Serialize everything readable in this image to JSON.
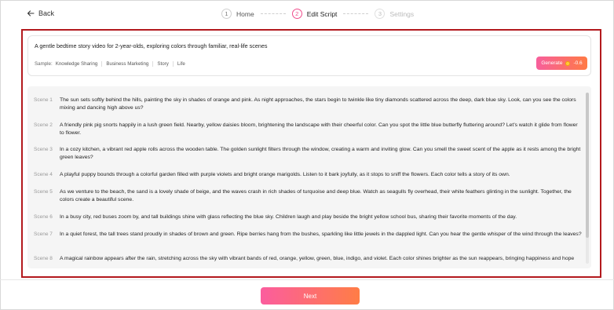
{
  "nav": {
    "back_label": "Back"
  },
  "steps": [
    {
      "num": "1",
      "label": "Home"
    },
    {
      "num": "2",
      "label": "Edit Script"
    },
    {
      "num": "3",
      "label": "Settings"
    }
  ],
  "prompt": {
    "text": "A gentle bedtime story video for 2-year-olds, exploring colors through familiar, real-life scenes",
    "sample_label": "Sample:",
    "samples": [
      "Knowledge Sharing",
      "Business Marketing",
      "Story",
      "Life"
    ],
    "generate_label": "Generate",
    "generate_cost": "-0.6"
  },
  "scenes": [
    {
      "label": "Scene 1",
      "text": "The sun sets softly behind the hills, painting the sky in shades of orange and pink. As night approaches, the stars begin to twinkle like tiny diamonds scattered across the deep, dark blue sky. Look, can you see the colors mixing and dancing high above us?"
    },
    {
      "label": "Scene 2",
      "text": "A friendly pink pig snorts happily in a lush green field. Nearby, yellow daisies bloom, brightening the landscape with their cheerful color. Can you spot the little blue butterfly fluttering around? Let's watch it glide from flower to flower."
    },
    {
      "label": "Scene 3",
      "text": "In a cozy kitchen, a vibrant red apple rolls across the wooden table. The golden sunlight filters through the window, creating a warm and inviting glow. Can you smell the sweet scent of the apple as it rests among the bright green leaves?"
    },
    {
      "label": "Scene 4",
      "text": "A playful puppy bounds through a colorful garden filled with purple violets and bright orange marigolds. Listen to it bark joyfully, as it stops to sniff the flowers. Each color tells a story of its own."
    },
    {
      "label": "Scene 5",
      "text": "As we venture to the beach, the sand is a lovely shade of beige, and the waves crash in rich shades of turquoise and deep blue. Watch as seagulls fly overhead, their white feathers glinting in the sunlight. Together, the colors create a beautiful scene."
    },
    {
      "label": "Scene 6",
      "text": "In a busy city, red buses zoom by, and tall buildings shine with glass reflecting the blue sky. Children laugh and play beside the bright yellow school bus, sharing their favorite moments of the day."
    },
    {
      "label": "Scene 7",
      "text": "In a quiet forest, the tall trees stand proudly in shades of brown and green. Ripe berries hang from the bushes, sparkling like little jewels in the dappled light. Can you hear the gentle whisper of the wind through the leaves?"
    },
    {
      "label": "Scene 8",
      "text": "A magical rainbow appears after the rain, stretching across the sky with vibrant bands of red, orange, yellow, green, blue, indigo, and violet. Each color shines brighter as the sun reappears, bringing happiness and hope"
    }
  ],
  "footer": {
    "next_label": "Next"
  },
  "colors": {
    "accent_pink": "#f04d8c",
    "accent_orange": "#ff7a45",
    "highlight_red": "#b3191d"
  }
}
